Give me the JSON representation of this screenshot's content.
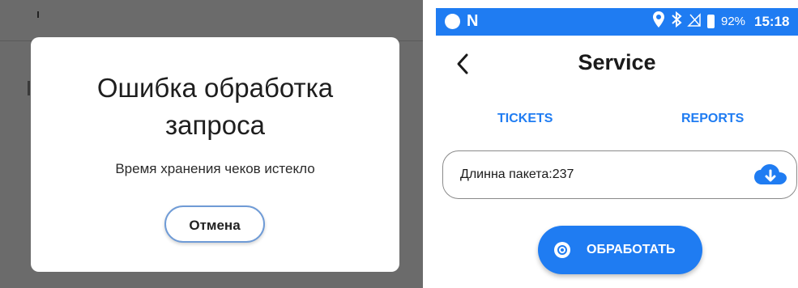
{
  "left_panel": {
    "dialog": {
      "title": "Ошибка обработка запроса",
      "message": "Время хранения чеков истекло",
      "cancel_label": "Отмена"
    }
  },
  "right_panel": {
    "status_bar": {
      "icons": [
        "circle-icon",
        "n-icon",
        "location-icon",
        "bluetooth-icon",
        "signal-icon",
        "battery-icon"
      ],
      "n_glyph": "N",
      "battery_percent": "92%",
      "time": "15:18"
    },
    "header": {
      "title": "Service",
      "back_icon": "chevron-left-icon"
    },
    "tabs": [
      {
        "label": "TICKETS"
      },
      {
        "label": "REPORTS"
      }
    ],
    "packet_field": {
      "label": "Длинна пакета:237",
      "icon": "cloud-download-icon"
    },
    "process_button": {
      "label": "ОБРАБОТАТЬ",
      "icon": "gear-icon"
    }
  },
  "colors": {
    "accent": "#1f7cf2",
    "overlay": "#6b6b6b",
    "dialog_button_border": "#6f9bd6"
  }
}
